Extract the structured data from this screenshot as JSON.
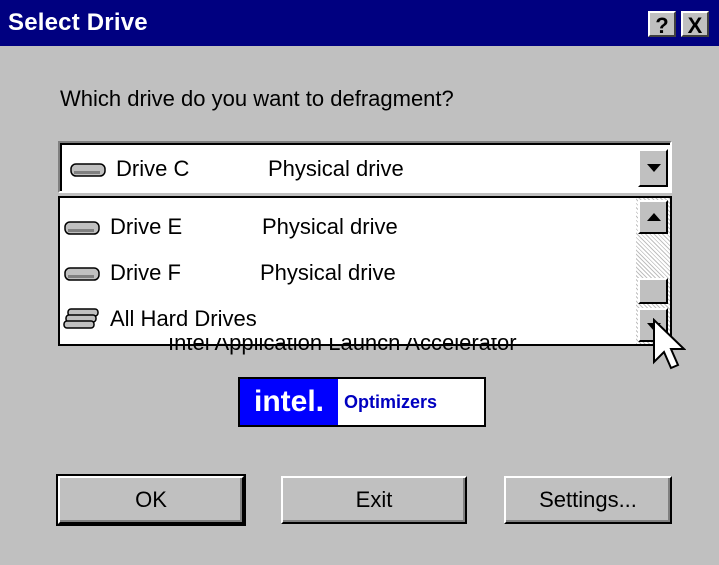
{
  "window": {
    "title": "Select Drive",
    "help_button": "?",
    "close_button": "X"
  },
  "prompt": "Which drive do you want to defragment?",
  "combo": {
    "selected": {
      "name": "Drive C",
      "type": "Physical drive",
      "icon": "drive-icon"
    }
  },
  "dropdown": {
    "items": [
      {
        "name": "Drive E",
        "type": "Physical drive",
        "icon": "drive-icon"
      },
      {
        "name": "Drive F",
        "type": "Physical drive",
        "icon": "drive-icon"
      },
      {
        "name": "All Hard Drives",
        "type": "",
        "icon": "all-drives-icon"
      }
    ]
  },
  "obscured_text": "Intel Application Launch Accelerator",
  "logo": {
    "brand": "intel.",
    "product": "Optimizers",
    "brand_color": "#0000ff"
  },
  "buttons": {
    "ok": "OK",
    "exit": "Exit",
    "settings": "Settings..."
  }
}
